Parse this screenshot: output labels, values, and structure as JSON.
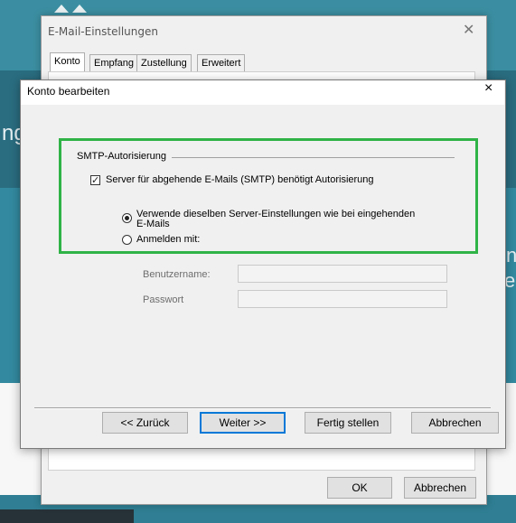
{
  "back_dialog": {
    "title": "E-Mail-Einstellungen",
    "tabs": [
      "Konto",
      "Empfang",
      "Zustellung",
      "Erweitert"
    ],
    "ok_label": "OK",
    "cancel_label": "Abbrechen"
  },
  "background": {
    "text_left": "ng",
    "text_right_1": "n",
    "text_right_2": "er"
  },
  "dialog": {
    "title": "Konto bearbeiten",
    "close_glyph": "×",
    "group_title": "SMTP-Autorisierung",
    "checkbox_label": "Server für abgehende E-Mails (SMTP) benötigt Autorisierung",
    "checkbox_checked": true,
    "radio_same_line1": "Verwende dieselben Server-Einstellungen wie bei eingehenden",
    "radio_same_line2": "E-Mails",
    "radio_login": "Anmelden mit:",
    "selected_radio": "same",
    "username_label": "Benutzername:",
    "password_label": "Passwort",
    "username_value": "",
    "password_value": "",
    "highlight_color": "#2fb346"
  },
  "buttons": {
    "back": "<< Zurück",
    "next": "Weiter >>",
    "finish": "Fertig stellen",
    "cancel": "Abbrechen"
  }
}
